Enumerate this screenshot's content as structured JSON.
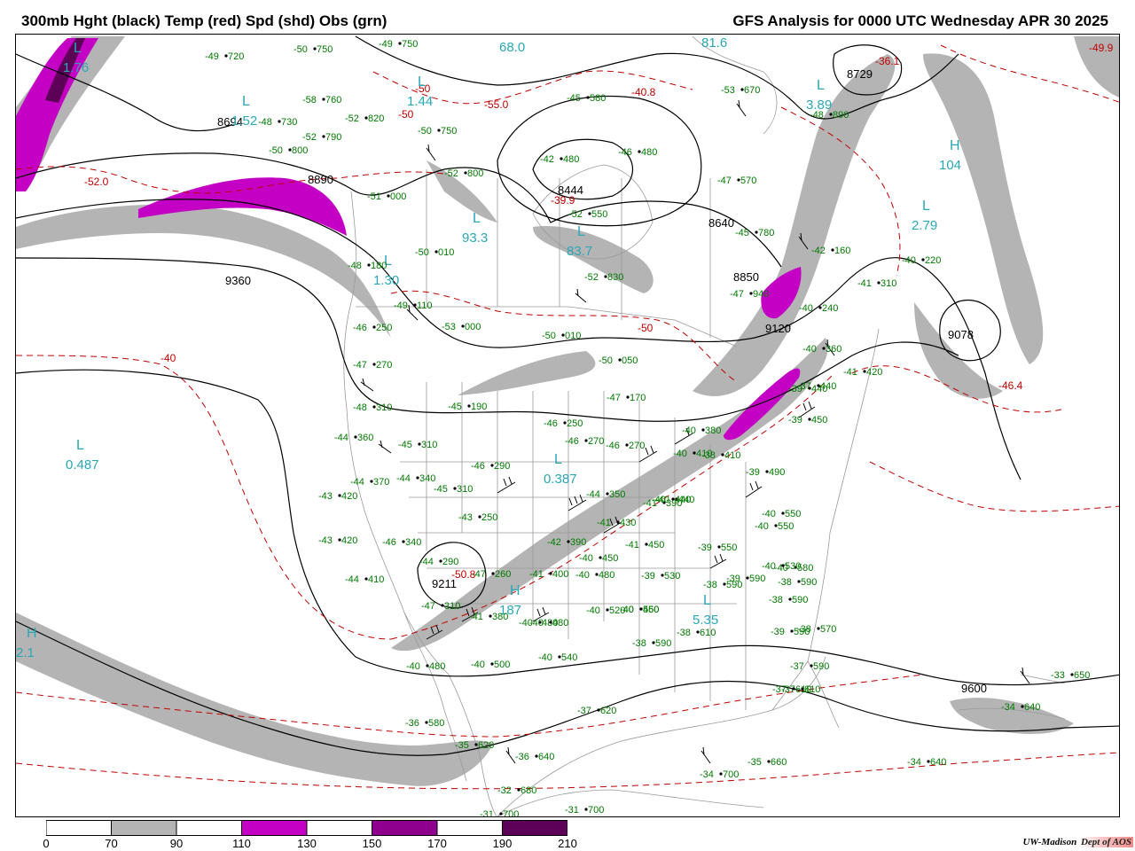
{
  "header": {
    "title_left": "300mb Hght (black) Temp (red) Spd (shd) Obs (grn)",
    "title_right": "GFS Analysis for 0000 UTC Wednesday  APR 30 2025"
  },
  "colors": {
    "height_contour": "#000000",
    "temp_contour": "#c00000",
    "obs": "#007a00",
    "geography": "#9a9a9a",
    "centers": "#2aa7b5",
    "speed_70_90": "#b4b4b4",
    "speed_110_130": "#c400c4",
    "speed_150_170": "#90008f",
    "speed_190_210": "#5c0058"
  },
  "legend": {
    "ticks": [
      "0",
      "70",
      "90",
      "110",
      "130",
      "150",
      "170",
      "190",
      "210"
    ],
    "fills": [
      "#ffffff",
      "#b4b4b4",
      "#ffffff",
      "#c400c4",
      "#ffffff",
      "#90008f",
      "#ffffff",
      "#5c0058"
    ]
  },
  "credit": {
    "org": "UW-Madison",
    "dept": "Dept of AOS"
  },
  "height_labels": [
    "8890",
    "8694",
    "8640",
    "8850",
    "9120",
    "9360",
    "9211",
    "9600",
    "9078",
    "8729",
    "8444"
  ],
  "temp_labels": [
    "-52.0",
    "-55.0",
    "-50",
    "-50",
    "-40.8",
    "-39.9",
    "-50",
    "-40",
    "-50.8",
    "-46.4",
    "-49.9",
    "-36.1"
  ],
  "pressure_centers": [
    {
      "type": "L",
      "value": "1.76"
    },
    {
      "type": "L",
      "value": "1.44"
    },
    {
      "type": "L",
      "value": "68.0"
    },
    {
      "type": "L",
      "value": "81.6"
    },
    {
      "type": "L",
      "value": "1.52"
    },
    {
      "type": "L",
      "value": "93.3"
    },
    {
      "type": "L",
      "value": "83.7"
    },
    {
      "type": "L",
      "value": "3.89"
    },
    {
      "type": "H",
      "value": "104"
    },
    {
      "type": "L",
      "value": "2.79"
    },
    {
      "type": "L",
      "value": "0.487"
    },
    {
      "type": "L",
      "value": "0.387"
    },
    {
      "type": "H",
      "value": "187"
    },
    {
      "type": "L",
      "value": "5.35"
    },
    {
      "type": "H",
      "value": "2.1"
    },
    {
      "type": "L",
      "value": "1.30"
    }
  ],
  "observations": [
    {
      "t": "-50",
      "h": "750"
    },
    {
      "t": "-49",
      "h": "750"
    },
    {
      "t": "-49",
      "h": "720"
    },
    {
      "t": "-58",
      "h": "760"
    },
    {
      "t": "-52",
      "h": "820"
    },
    {
      "t": "-48",
      "h": "730"
    },
    {
      "t": "-52",
      "h": "790"
    },
    {
      "t": "-50",
      "h": "800"
    },
    {
      "t": "-51",
      "h": "000"
    },
    {
      "t": "-50",
      "h": "750"
    },
    {
      "t": "-52",
      "h": "800"
    },
    {
      "t": "-48",
      "h": "180"
    },
    {
      "t": "-50",
      "h": "010"
    },
    {
      "t": "-49",
      "h": "110"
    },
    {
      "t": "-46",
      "h": "250"
    },
    {
      "t": "-47",
      "h": "270"
    },
    {
      "t": "-48",
      "h": "310"
    },
    {
      "t": "-44",
      "h": "360"
    },
    {
      "t": "-44",
      "h": "370"
    },
    {
      "t": "-43",
      "h": "420"
    },
    {
      "t": "-43",
      "h": "420"
    },
    {
      "t": "-44",
      "h": "410"
    },
    {
      "t": "-47",
      "h": "310"
    },
    {
      "t": "-41",
      "h": "380"
    },
    {
      "t": "-40",
      "h": "480"
    },
    {
      "t": "-45",
      "h": "310"
    },
    {
      "t": "-44",
      "h": "340"
    },
    {
      "t": "-45",
      "h": "310"
    },
    {
      "t": "-46",
      "h": "290"
    },
    {
      "t": "-43",
      "h": "250"
    },
    {
      "t": "-46",
      "h": "340"
    },
    {
      "t": "-44",
      "h": "290"
    },
    {
      "t": "-47",
      "h": "260"
    },
    {
      "t": "-53",
      "h": "000"
    },
    {
      "t": "-50",
      "h": "010"
    },
    {
      "t": "-52",
      "h": "830"
    },
    {
      "t": "-50",
      "h": "050"
    },
    {
      "t": "-47",
      "h": "170"
    },
    {
      "t": "-45",
      "h": "190"
    },
    {
      "t": "-46",
      "h": "250"
    },
    {
      "t": "-46",
      "h": "270"
    },
    {
      "t": "-46",
      "h": "270"
    },
    {
      "t": "-44",
      "h": "350"
    },
    {
      "t": "-41",
      "h": "430"
    },
    {
      "t": "-42",
      "h": "390"
    },
    {
      "t": "-41",
      "h": "400"
    },
    {
      "t": "-40",
      "h": "450"
    },
    {
      "t": "-40",
      "h": "480"
    },
    {
      "t": "-40",
      "h": "520"
    },
    {
      "t": "-40",
      "h": "460"
    },
    {
      "t": "-40",
      "h": "500"
    },
    {
      "t": "-40",
      "h": "540"
    },
    {
      "t": "-41",
      "h": "390"
    },
    {
      "t": "-40",
      "h": "440"
    },
    {
      "t": "-41",
      "h": "450"
    },
    {
      "t": "-39",
      "h": "530"
    },
    {
      "t": "-40",
      "h": "550"
    },
    {
      "t": "-38",
      "h": "590"
    },
    {
      "t": "-38",
      "h": "610"
    },
    {
      "t": "-39",
      "h": "550"
    },
    {
      "t": "-38",
      "h": "590"
    },
    {
      "t": "-39",
      "h": "590"
    },
    {
      "t": "-38",
      "h": "590"
    },
    {
      "t": "-37",
      "h": "610"
    },
    {
      "t": "-37",
      "h": "620"
    },
    {
      "t": "-36",
      "h": "640"
    },
    {
      "t": "-35",
      "h": "620"
    },
    {
      "t": "-36",
      "h": "580"
    },
    {
      "t": "-40",
      "h": "480"
    },
    {
      "t": "-32",
      "h": "680"
    },
    {
      "t": "-31",
      "h": "700"
    },
    {
      "t": "-31",
      "h": "700"
    },
    {
      "t": "-34",
      "h": "700"
    },
    {
      "t": "-35",
      "h": "660"
    },
    {
      "t": "-34",
      "h": "640"
    },
    {
      "t": "-34",
      "h": "640"
    },
    {
      "t": "-33",
      "h": "650"
    },
    {
      "t": "-37",
      "h": "610"
    },
    {
      "t": "-37",
      "h": "590"
    },
    {
      "t": "-39",
      "h": "590"
    },
    {
      "t": "-38",
      "h": "570"
    },
    {
      "t": "-38",
      "h": "590"
    },
    {
      "t": "-40",
      "h": "580"
    },
    {
      "t": "-40",
      "h": "550"
    },
    {
      "t": "-40",
      "h": "550"
    },
    {
      "t": "-40",
      "h": "530"
    },
    {
      "t": "-39",
      "h": "490"
    },
    {
      "t": "-39",
      "h": "450"
    },
    {
      "t": "-40",
      "h": "440"
    },
    {
      "t": "-39",
      "h": "440"
    },
    {
      "t": "-38",
      "h": "410"
    },
    {
      "t": "-40",
      "h": "410"
    },
    {
      "t": "-40",
      "h": "380"
    },
    {
      "t": "-37",
      "h": "440"
    },
    {
      "t": "-41",
      "h": "420"
    },
    {
      "t": "-40",
      "h": "360"
    },
    {
      "t": "-40",
      "h": "240"
    },
    {
      "t": "-42",
      "h": "160"
    },
    {
      "t": "-40",
      "h": "220"
    },
    {
      "t": "-41",
      "h": "310"
    },
    {
      "t": "-47",
      "h": "940"
    },
    {
      "t": "-45",
      "h": "780"
    },
    {
      "t": "-47",
      "h": "570"
    },
    {
      "t": "-53",
      "h": "670"
    },
    {
      "t": "-48",
      "h": "890"
    },
    {
      "t": "-46",
      "h": "480"
    },
    {
      "t": "-45",
      "h": "580"
    },
    {
      "t": "-42",
      "h": "480"
    },
    {
      "t": "-52",
      "h": "550"
    },
    {
      "t": "-40",
      "h": "480"
    }
  ]
}
